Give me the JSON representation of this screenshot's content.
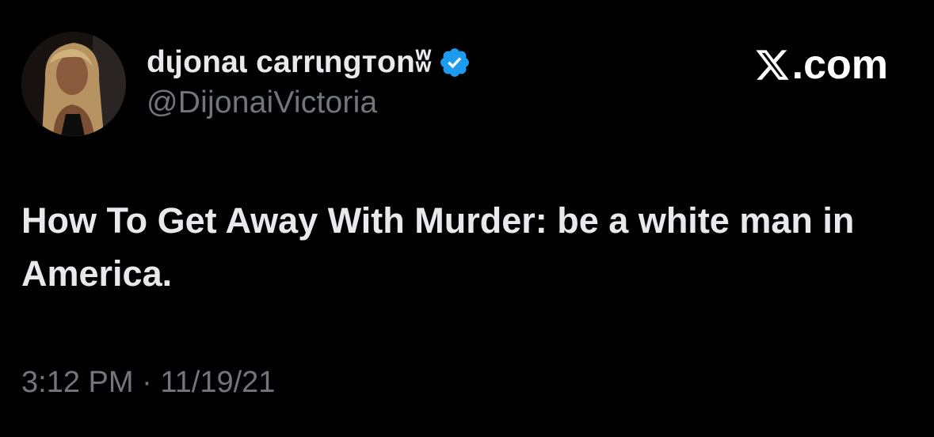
{
  "tweet": {
    "author": {
      "display_name": "dɩjonaɩ carrɩngтonʬ",
      "crown_icon": "♛",
      "handle": "@DijonaiVictoria",
      "verified_icon": "verified-badge-icon",
      "verified_color": "#1d9bf0"
    },
    "site": {
      "mark_icon": "x-logo-icon",
      "suffix": ".com"
    },
    "text": "How To Get Away With Murder: be a white man in America.",
    "time": "3:12 PM",
    "separator": "·",
    "date": "11/19/21"
  },
  "colors": {
    "background": "#000000",
    "primary_text": "#e7e9ea",
    "secondary_text": "#71767b",
    "accent": "#1d9bf0"
  }
}
